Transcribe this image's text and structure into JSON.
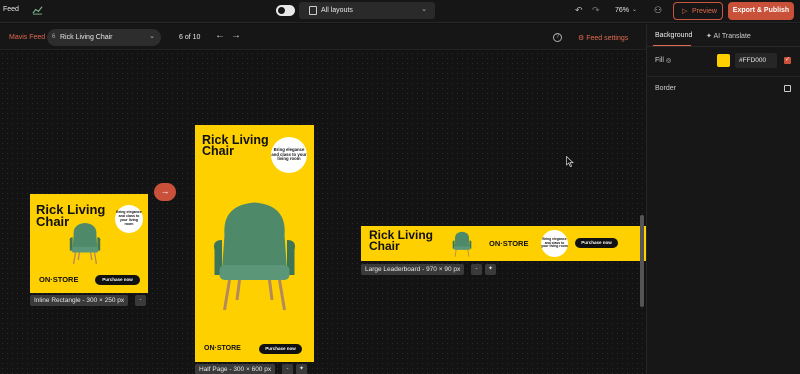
{
  "topbar": {
    "feed_title": "Feed",
    "layouts_label": "All layouts",
    "zoom": "76%",
    "preview_label": "Preview",
    "publish_label": "Export & Publish"
  },
  "toolbar": {
    "feed_name": "Mavis Feed",
    "item_number": "6",
    "item_name": "Rick Living Chair",
    "page_count": "6 of 10",
    "feed_settings": "Feed settings"
  },
  "sidebar": {
    "tab_background": "Background",
    "tab_translate": "AI Translate",
    "fill_label": "Fill",
    "fill_hex": "#FFD000",
    "border_label": "Border"
  },
  "colors": {
    "accent": "#c9513a",
    "ad_background": "#FFD000",
    "chair": "#4e8a6a"
  },
  "ads": {
    "inline": {
      "title": "Rick Living Chair",
      "bubble": "Bring elegance and class to your living room",
      "brand": "ON·STORE",
      "cta": "Purchase now",
      "size": "Inline Rectangle - 300 × 250 px"
    },
    "halfpage": {
      "title": "Rick Living Chair",
      "bubble": "Bring elegance and class to your living room",
      "brand": "ON·STORE",
      "cta": "Purchase now",
      "size": "Half Page - 300 × 600 px"
    },
    "leaderboard": {
      "title": "Rick Living Chair",
      "bubble": "Bring elegance and class to your living room",
      "brand": "ON·STORE",
      "cta": "Purchase now",
      "size": "Large Leaderboard - 970 × 90 px"
    }
  }
}
